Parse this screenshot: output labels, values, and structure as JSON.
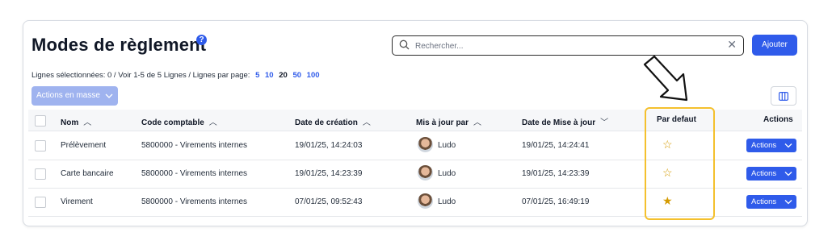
{
  "header": {
    "title": "Modes de règlement",
    "help_glyph": "?"
  },
  "search": {
    "placeholder": "Rechercher...",
    "clear_glyph": "✕"
  },
  "add_button": {
    "label": "Ajouter"
  },
  "info": {
    "selected": "Lignes sélectionnées: 0 /",
    "view": "Voir 1-5 de 5 Lignes /",
    "per_page_label": "Lignes par page:",
    "page_sizes": [
      "5",
      "10",
      "20",
      "50",
      "100"
    ],
    "active_page_size": "20"
  },
  "mass_actions": {
    "label": "Actions en masse"
  },
  "table": {
    "columns": {
      "name": "Nom",
      "code": "Code comptable",
      "created": "Date de création",
      "updated_by": "Mis à jour par",
      "updated": "Date de Mise à jour",
      "default": "Par defaut",
      "actions": "Actions"
    },
    "rows": [
      {
        "name": "Prélèvement",
        "code": "5800000 - Virements internes",
        "created": "19/01/25, 14:24:03",
        "updated_by": "Ludo",
        "updated": "19/01/25, 14:24:41",
        "is_default": false,
        "action_label": "Actions"
      },
      {
        "name": "Carte bancaire",
        "code": "5800000 - Virements internes",
        "created": "19/01/25, 14:23:39",
        "updated_by": "Ludo",
        "updated": "19/01/25, 14:23:39",
        "is_default": false,
        "action_label": "Actions"
      },
      {
        "name": "Virement",
        "code": "5800000 - Virements internes",
        "created": "07/01/25, 09:52:43",
        "updated_by": "Ludo",
        "updated": "07/01/25, 16:49:19",
        "is_default": true,
        "action_label": "Actions"
      }
    ]
  },
  "colors": {
    "accent": "#2f5bea",
    "mass_disabled": "#9fb3ef",
    "highlight": "#f4c02d",
    "star": "#d49a00"
  },
  "icons": {
    "search": "search-icon",
    "help": "help-circle-icon",
    "columns": "columns-icon",
    "star_empty": "star-outline-icon",
    "star_filled": "star-filled-icon",
    "chevron": "chevron-down-icon",
    "sort": "chevron-up-icon"
  }
}
